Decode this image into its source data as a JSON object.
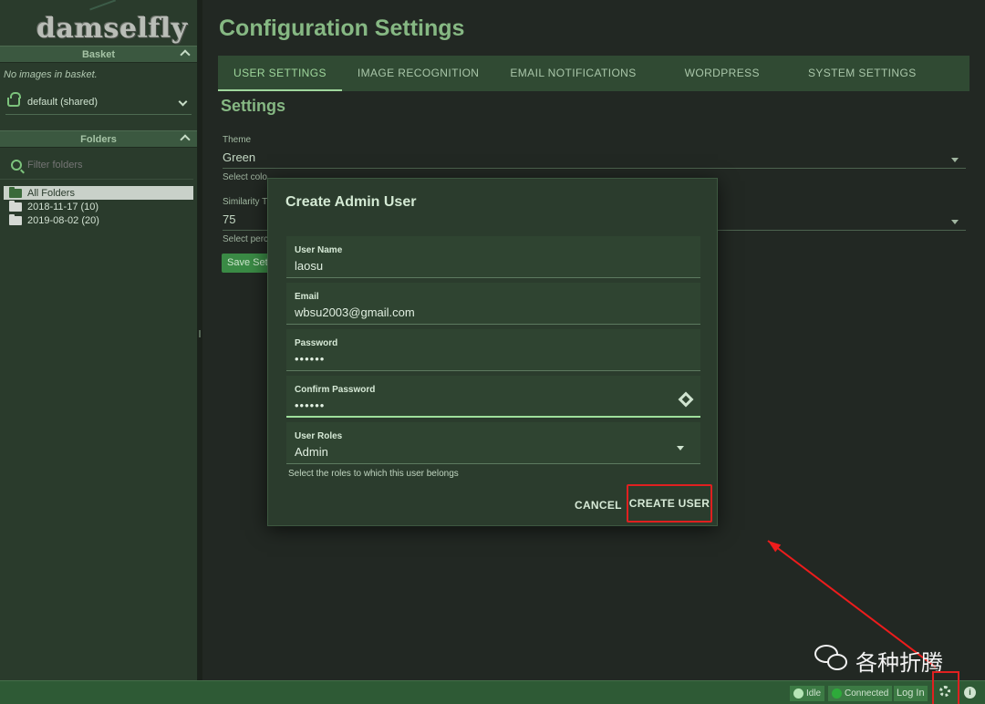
{
  "app": {
    "logo": "damselfly"
  },
  "sidebar": {
    "basket": {
      "header": "Basket",
      "empty_text": "No images in basket.",
      "selected": "default (shared)"
    },
    "folders": {
      "header": "Folders",
      "filter_placeholder": "Filter folders",
      "items": [
        {
          "label": "All Folders"
        },
        {
          "label": "2018-11-17 (10)"
        },
        {
          "label": "2019-08-02 (20)"
        }
      ]
    }
  },
  "main": {
    "title": "Configuration Settings",
    "tabs": [
      {
        "label": "USER SETTINGS"
      },
      {
        "label": "IMAGE RECOGNITION"
      },
      {
        "label": "EMAIL NOTIFICATIONS"
      },
      {
        "label": "WORDPRESS"
      },
      {
        "label": "SYSTEM SETTINGS"
      }
    ],
    "section_title": "Settings",
    "theme": {
      "label": "Theme",
      "value": "Green",
      "hint": "Select colo"
    },
    "similarity": {
      "label": "Similarity T",
      "value": "75",
      "hint": "Select perc"
    },
    "save_label": "Save Set"
  },
  "dialog": {
    "title": "Create Admin User",
    "username": {
      "label": "User Name",
      "value": "laosu"
    },
    "email": {
      "label": "Email",
      "value": "wbsu2003@gmail.com"
    },
    "password": {
      "label": "Password",
      "value": "••••••"
    },
    "confirm": {
      "label": "Confirm Password",
      "value": "••••••"
    },
    "roles": {
      "label": "User Roles",
      "value": "Admin",
      "hint": "Select the roles to which this user belongs"
    },
    "cancel_label": "CANCEL",
    "create_label": "CREATE USER"
  },
  "watermark": {
    "text": "各种折腾"
  },
  "statusbar": {
    "idle": "Idle",
    "connected": "Connected",
    "login": "Log In",
    "info_glyph": "i"
  },
  "colors": {
    "accent": "#9fd69c",
    "annotation": "#e02020",
    "statusbar": "#2e5a35"
  }
}
